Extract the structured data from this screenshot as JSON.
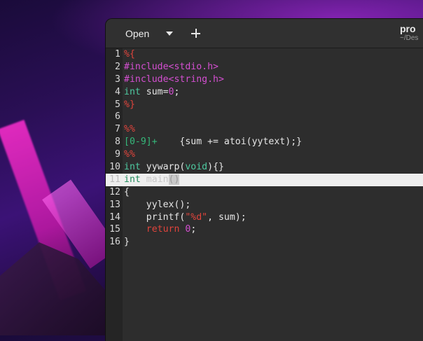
{
  "window": {
    "title": "pro",
    "subtitle": "~/Des"
  },
  "headerbar": {
    "open_label": "Open"
  },
  "editor": {
    "current_line": 11,
    "lines": [
      {
        "n": "1",
        "t": "%{"
      },
      {
        "n": "2",
        "t": "#include<stdio.h>"
      },
      {
        "n": "3",
        "t": "#include<string.h>"
      },
      {
        "n": "4",
        "t": "int sum=0;"
      },
      {
        "n": "5",
        "t": "%}"
      },
      {
        "n": "6",
        "t": ""
      },
      {
        "n": "7",
        "t": "%%"
      },
      {
        "n": "8",
        "t": "[0-9]+    {sum += atoi(yytext);}"
      },
      {
        "n": "9",
        "t": "%%"
      },
      {
        "n": "10",
        "t": "int yywarp(void){}"
      },
      {
        "n": "11",
        "t": "int main()"
      },
      {
        "n": "12",
        "t": "{"
      },
      {
        "n": "13",
        "t": "    yylex();"
      },
      {
        "n": "14",
        "t": "    printf(\"%d\", sum);"
      },
      {
        "n": "15",
        "t": "    return 0;"
      },
      {
        "n": "16",
        "t": "}"
      }
    ]
  },
  "colors": {
    "keyword": "#4ec9a0",
    "preprocessor": "#d44fd1",
    "string": "#e0443c",
    "current_line_bg": "#eeeeee"
  }
}
